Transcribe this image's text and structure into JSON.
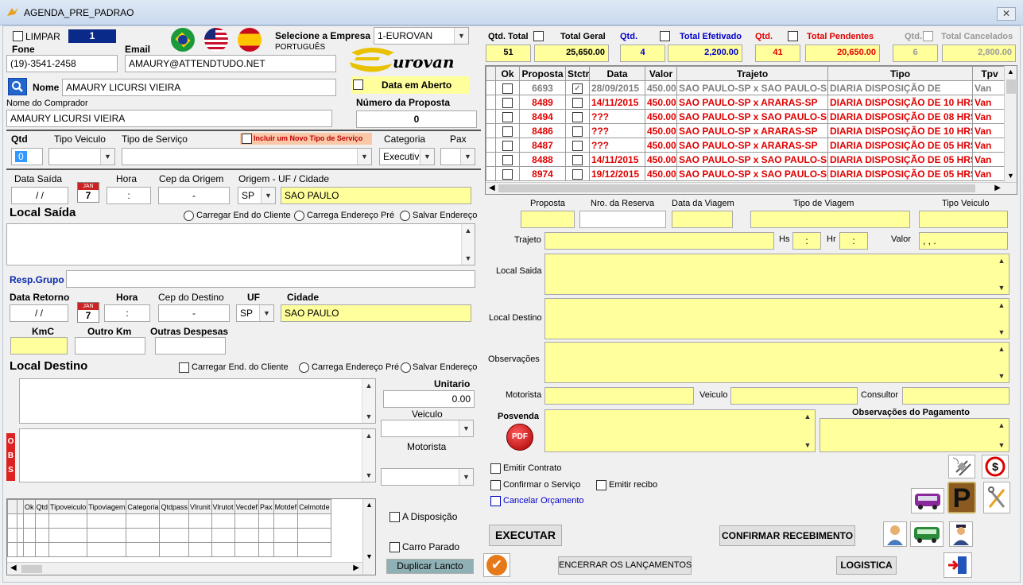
{
  "window": {
    "title": "AGENDA_PRE_PADRAO",
    "close": "✕"
  },
  "left": {
    "limpar_label": "LIMPAR",
    "counter": "1",
    "fone_label": "Fone",
    "fone_value": "(19)-3541-2458",
    "email_label": "Email",
    "email_value": "AMAURY@ATTENDTUDO.NET",
    "empresa_label": "Selecione a Empresa",
    "empresa_value": "1-EUROVAN",
    "language_label": "PORTUGUÊS",
    "logo_text": "urovan",
    "nome_label": "Nome",
    "nome_value": "AMAURY LICURSI VIEIRA",
    "data_aberto_label": "Data em Aberto",
    "comprador_label": "Nome do Comprador",
    "comprador_value": "AMAURY LICURSI VIEIRA",
    "numero_proposta_label": "Número da Proposta",
    "numero_proposta_value": "0",
    "qtd_label": "Qtd",
    "qtd_value": "0",
    "tipo_veiculo_label": "Tipo Veiculo",
    "tipo_servico_label": "Tipo de Serviço",
    "novo_tipo_label": "Incluir um Novo Tipo de Serviço",
    "categoria_label": "Categoria",
    "categoria_value": "Executivo",
    "pax_label": "Pax",
    "data_saida_label": "Data Saída",
    "data_saida_value": " / /",
    "hora_label": "Hora",
    "hora_value": ":",
    "cep_origem_label": "Cep da Origem",
    "cep_origem_value": "-",
    "origem_label": "Origem - UF / Cidade",
    "uf_origem": "SP",
    "cidade_origem": "SAO PAULO",
    "local_saida_label": "Local Saída",
    "carregar_cliente_label": "Carregar End do Cliente",
    "carrega_pre_label": "Carrega Endereço Pré",
    "salvar_endereco_label": "Salvar Endereço",
    "resp_grupo_label": "Resp.Grupo",
    "data_retorno_label": "Data Retorno",
    "data_retorno_value": " / /",
    "hora2_label": "Hora",
    "hora2_value": ":",
    "cep_destino_label": "Cep do Destino",
    "cep_destino_value": "-",
    "uf_label": "UF",
    "uf_destino": "SP",
    "cidade_label": "Cidade",
    "cidade_destino": "SAO PAULO",
    "kmc_label": "KmC",
    "outro_km_label": "Outro Km",
    "outras_despesas_label": "Outras Despesas",
    "local_destino_label": "Local Destino",
    "carregar_cliente2_label": "Carregar End.  do Cliente",
    "carrega_pre2_label": "Carrega Endereço Pré",
    "salvar_endereco2_label": "Salvar Endereço",
    "unitario_label": "Unitario",
    "unitario_value": "0.00",
    "veiculo_label": "Veiculo",
    "motorista_label": "Motorista",
    "obs_letters": [
      "O",
      "B",
      "S"
    ],
    "grid_headers": [
      "Ok",
      "Qtd",
      "Tipoveiculo",
      "Tipoviagem",
      "Categoria",
      "Qtdpass",
      "Vlrunit",
      "Vlrutot",
      "Vecdef",
      "Pax",
      "Motdef",
      "Celmotde"
    ],
    "a_disposicao_label": "A Disposição",
    "carro_parado_label": "Carro Parado",
    "duplicar_label": "Duplicar Lancto",
    "encerrar_label": "ENCERRAR  OS LANÇAMENTOS"
  },
  "summary": {
    "qtd_total_label": "Qtd. Total",
    "total_geral_label": "Total Geral",
    "qtd_total_value": "51",
    "total_geral_value": "25,650.00",
    "qtd_efet_label": "Qtd.",
    "total_efet_label": "Total Efetivado",
    "qtd_efet_value": "4",
    "total_efet_value": "2,200.00",
    "qtd_pend_label": "Qtd.",
    "total_pend_label": "Total Pendentes",
    "qtd_pend_value": "41",
    "total_pend_value": "20,650.00",
    "qtd_canc_label": "Qtd.",
    "total_canc_label": "Total Cancelados",
    "qtd_canc_value": "6",
    "total_canc_value": "2,800.00"
  },
  "table": {
    "headers": [
      "Ok",
      "Proposta",
      "Stctr",
      "Data",
      "Valor",
      "Trajeto",
      "Tipo",
      "Tpv"
    ],
    "rows": [
      {
        "proposta": "6693",
        "stctr": true,
        "data": "28/09/2015",
        "valor": "450.00",
        "trajeto": "SAO PAULO-SP x SAO PAULO-SP",
        "tipo": "DIARIA DISPOSIÇÃO DE",
        "tpv": "Van",
        "gray": true
      },
      {
        "proposta": "8489",
        "stctr": false,
        "data": "14/11/2015",
        "valor": "450.00",
        "trajeto": "SAO PAULO-SP x ARARAS-SP",
        "tipo": "DIARIA DISPOSIÇÃO DE 10 HRS",
        "tpv": "Van",
        "gray": false
      },
      {
        "proposta": "8494",
        "stctr": false,
        "data": "???",
        "valor": "450.00",
        "trajeto": "SAO PAULO-SP x SAO PAULO-SP",
        "tipo": "DIARIA DISPOSIÇÃO DE 08 HRS",
        "tpv": "Van",
        "gray": false
      },
      {
        "proposta": "8486",
        "stctr": false,
        "data": "???",
        "valor": "450.00",
        "trajeto": "SAO PAULO-SP x ARARAS-SP",
        "tipo": "DIARIA DISPOSIÇÃO DE 10 HRS",
        "tpv": "Van",
        "gray": false
      },
      {
        "proposta": "8487",
        "stctr": false,
        "data": "???",
        "valor": "450.00",
        "trajeto": "SAO PAULO-SP x ARARAS-SP",
        "tipo": "DIARIA DISPOSIÇÃO DE 05 HRS",
        "tpv": "Van",
        "gray": false
      },
      {
        "proposta": "8488",
        "stctr": false,
        "data": "14/11/2015",
        "valor": "450.00",
        "trajeto": "SAO PAULO-SP x SAO PAULO-SP",
        "tipo": "DIARIA DISPOSIÇÃO DE 05 HRS",
        "tpv": "Van",
        "gray": false
      },
      {
        "proposta": "8974",
        "stctr": false,
        "data": "19/12/2015",
        "valor": "450.00",
        "trajeto": "SAO PAULO-SP x SAO PAULO-SP",
        "tipo": "DIARIA DISPOSIÇÃO DE 05 HRS",
        "tpv": "Van",
        "gray": false
      }
    ]
  },
  "detail": {
    "proposta_label": "Proposta",
    "reserva_label": "Nro. da Reserva",
    "data_viagem_label": "Data da Viagem",
    "tipo_viagem_label": "Tipo de Viagem",
    "tipo_veiculo_label": "Tipo Veiculo",
    "trajeto_label": "Trajeto",
    "hs_label": "Hs",
    "hs_value": ":",
    "hr_label": "Hr",
    "hr_value": ":",
    "valor_label": "Valor",
    "valor_value": ",  ,  .",
    "local_saida_label": "Local Saida",
    "local_destino_label": "Local Destino",
    "observacoes_label": "Observações",
    "motorista_label": "Motorista",
    "veiculo_label": "Veiculo",
    "consultor_label": "Consultor",
    "posvenda_label": "Posvenda",
    "pdf_label": "PDF",
    "obs_pagamento_label": "Observações do Pagamento",
    "emitir_contrato_label": "Emitir Contrato",
    "confirmar_servico_label": "Confirmar o Serviço",
    "emitir_recibo_label": "Emitir recibo",
    "cancelar_orcamento_label": "Cancelar Orçamento",
    "executar_label": "EXECUTAR",
    "confirmar_recebimento_label": "CONFIRMAR RECEBIMENTO",
    "logistica_label": "LOGISTICA",
    "p_label": "P"
  },
  "colors": {
    "accent_blue": "#0000cc",
    "red": "#e00000",
    "yellow": "#ffff9c",
    "gray_row": "#808080"
  }
}
